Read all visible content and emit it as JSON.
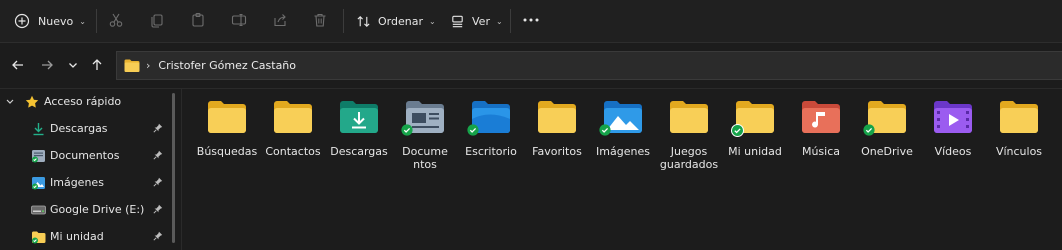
{
  "toolbar": {
    "new_label": "Nuevo",
    "sort_label": "Ordenar",
    "view_label": "Ver",
    "icons": [
      "new-icon",
      "cut-icon",
      "copy-icon",
      "paste-icon",
      "rename-icon",
      "share-icon",
      "delete-icon",
      "sort-icon",
      "view-icon",
      "more-icon"
    ]
  },
  "address": {
    "location": "Cristofer Gómez Castaño"
  },
  "sidebar": {
    "items": [
      {
        "label": "Acceso rápido",
        "icon": "star-icon"
      },
      {
        "label": "Descargas",
        "icon": "download-folder-icon"
      },
      {
        "label": "Documentos",
        "icon": "documents-folder-icon"
      },
      {
        "label": "Imágenes",
        "icon": "pictures-folder-icon"
      },
      {
        "label": "Google Drive (E:)",
        "icon": "drive-icon"
      },
      {
        "label": "Mi unidad",
        "icon": "folder-sync-icon"
      }
    ]
  },
  "folders": [
    {
      "label": "Búsquedas",
      "icon": "folder-icon"
    },
    {
      "label": "Contactos",
      "icon": "folder-icon"
    },
    {
      "label": "Descargas",
      "icon": "downloads-folder-icon"
    },
    {
      "label": "Documentos",
      "icon": "documents-folder-icon"
    },
    {
      "label": "Escritorio",
      "icon": "desktop-folder-icon"
    },
    {
      "label": "Favoritos",
      "icon": "folder-icon"
    },
    {
      "label": "Imágenes",
      "icon": "pictures-folder-icon"
    },
    {
      "label": "Juegos guardados",
      "icon": "folder-icon"
    },
    {
      "label": "Mi unidad",
      "icon": "folder-icon"
    },
    {
      "label": "Música",
      "icon": "music-folder-icon"
    },
    {
      "label": "OneDrive",
      "icon": "folder-icon"
    },
    {
      "label": "Vídeos",
      "icon": "videos-folder-icon"
    },
    {
      "label": "Vínculos",
      "icon": "folder-icon"
    }
  ],
  "colors": {
    "folder_yellow": "#f5c342",
    "sync_green": "#16a34a",
    "accent_blue": "#3b9ae1"
  }
}
